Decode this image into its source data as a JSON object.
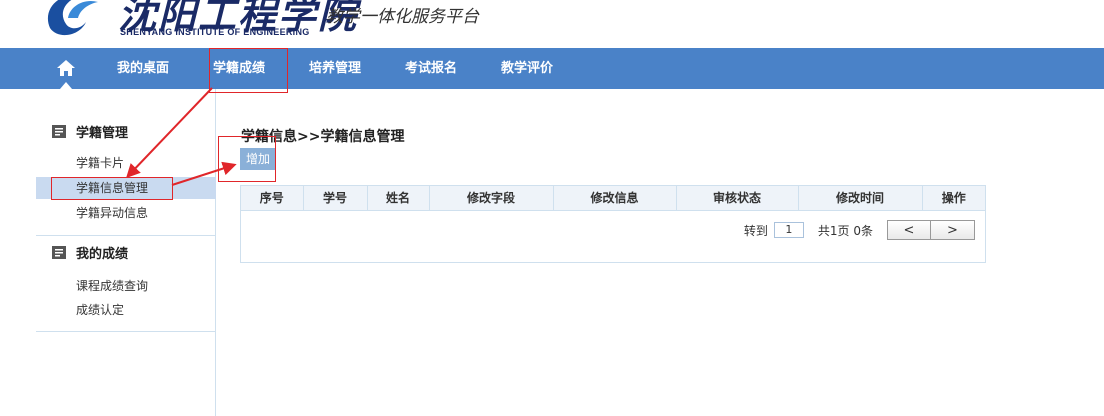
{
  "header": {
    "logo_cn": "沈阳工程学院",
    "logo_en": "SHENYANG INSTITUTE OF ENGINEERING",
    "platform": "教学一体化服务平台"
  },
  "nav": {
    "home_icon": "home-icon",
    "items": [
      {
        "label": "我的桌面"
      },
      {
        "label": "学籍成绩"
      },
      {
        "label": "培养管理"
      },
      {
        "label": "考试报名"
      },
      {
        "label": "教学评价"
      }
    ],
    "bar_color": "#4a82c8"
  },
  "sidebar": {
    "groups": [
      {
        "title": "学籍管理",
        "icon": "document-icon",
        "links": [
          {
            "label": "学籍卡片"
          },
          {
            "label": "学籍信息管理",
            "active": true
          },
          {
            "label": "学籍异动信息"
          }
        ]
      },
      {
        "title": "我的成绩",
        "icon": "document-icon",
        "links": [
          {
            "label": "课程成绩查询"
          },
          {
            "label": "成绩认定"
          }
        ]
      }
    ]
  },
  "main": {
    "breadcrumb": "学籍信息>>学籍信息管理",
    "add_button": "增加",
    "table": {
      "columns": [
        "序号",
        "学号",
        "姓名",
        "修改字段",
        "修改信息",
        "审核状态",
        "修改时间",
        "操作"
      ],
      "rows": []
    },
    "pager": {
      "goto_label": "转到",
      "page_value": "1",
      "info": "共1页 0条",
      "prev": "<",
      "next": ">"
    }
  },
  "annotations": {
    "color": "#e0262a"
  }
}
